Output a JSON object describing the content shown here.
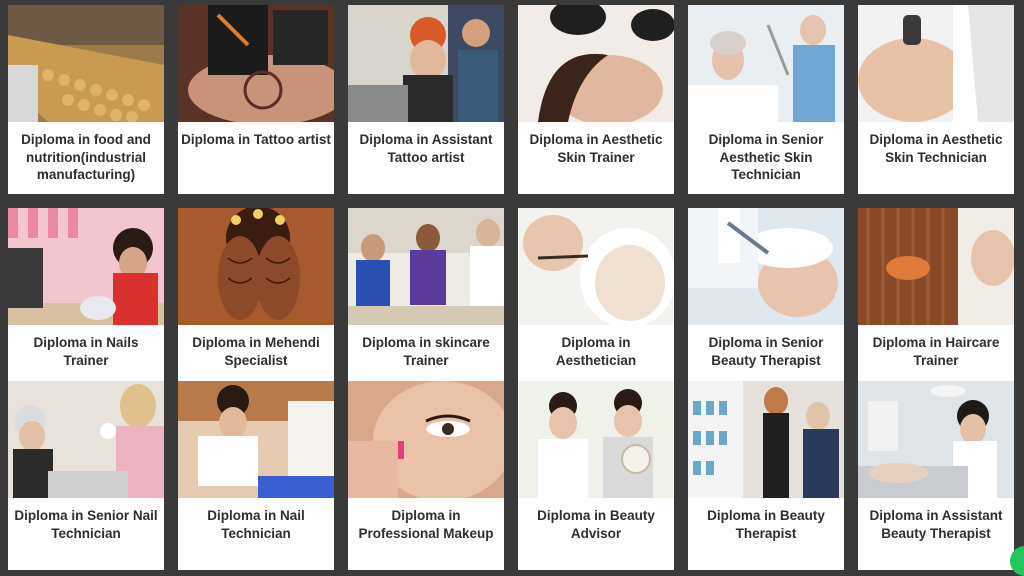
{
  "courses": [
    {
      "title": "Diploma in food and nutrition(industrial manufacturing)",
      "icon": "factory-conveyor-image",
      "tone": "#b8862e"
    },
    {
      "title": "Diploma in Tattoo artist",
      "icon": "tattoo-hand-image",
      "tone": "#6b3a2a"
    },
    {
      "title": "Diploma in Assistant Tattoo artist",
      "icon": "tattoo-studio-image",
      "tone": "#c8502a"
    },
    {
      "title": "Diploma in Aesthetic Skin Trainer",
      "icon": "facial-treatment-image",
      "tone": "#d9b9a6"
    },
    {
      "title": "Diploma in Senior Aesthetic Skin Technician",
      "icon": "skin-clinic-image",
      "tone": "#9fc2d8"
    },
    {
      "title": "Diploma in Aesthetic Skin Technician",
      "icon": "face-device-image",
      "tone": "#e7c7b2"
    },
    {
      "title": "Diploma in Nails Trainer",
      "icon": "nail-salon-image",
      "tone": "#d46a7a"
    },
    {
      "title": "Diploma in Mehendi Specialist",
      "icon": "mehendi-hands-image",
      "tone": "#7a3d1f"
    },
    {
      "title": "Diploma in skincare Trainer",
      "icon": "skincare-class-image",
      "tone": "#5c6bb0"
    },
    {
      "title": "Diploma in Aesthetician",
      "icon": "face-mask-image",
      "tone": "#e9dcd2"
    },
    {
      "title": "Diploma in Senior Beauty Therapist",
      "icon": "beauty-therapy-image",
      "tone": "#c9d7e3"
    },
    {
      "title": "Diploma in Haircare Trainer",
      "icon": "hair-brush-image",
      "tone": "#9a5a36"
    },
    {
      "title": "Diploma in Senior Nail Technician",
      "icon": "nail-technician-image",
      "tone": "#c7b7a8"
    },
    {
      "title": "Diploma in Nail Technician",
      "icon": "manicure-image",
      "tone": "#d3a27a"
    },
    {
      "title": "Diploma in Professional Makeup",
      "icon": "eye-makeup-image",
      "tone": "#e0b49a"
    },
    {
      "title": "Diploma in Beauty Advisor",
      "icon": "beauty-advisor-image",
      "tone": "#e8d7cc"
    },
    {
      "title": "Diploma in Beauty Therapist",
      "icon": "hair-salon-image",
      "tone": "#4a4a5a"
    },
    {
      "title": "Diploma in Assistant Beauty Therapist",
      "icon": "spa-room-image",
      "tone": "#b7c4cc"
    }
  ],
  "chat_icon": "chat-bubble-icon"
}
